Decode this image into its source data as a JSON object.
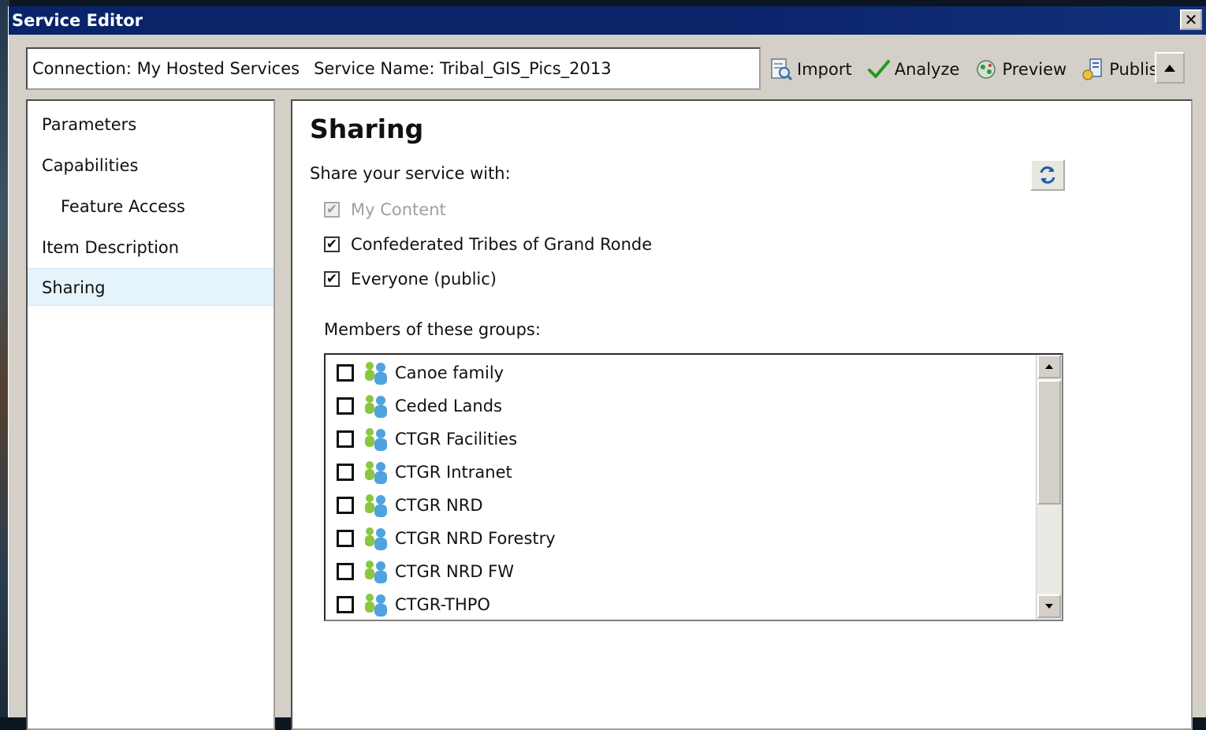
{
  "window": {
    "title": "Service Editor",
    "close_glyph": "✕"
  },
  "info": {
    "connection": "Connection: My Hosted Services",
    "service_name": "Service Name: Tribal_GIS_Pics_2013"
  },
  "toolbar": {
    "import_label": "Import",
    "analyze_label": "Analyze",
    "preview_label": "Preview",
    "publish_label": "Publish",
    "collapse_icon": "triangle-up-icon"
  },
  "nav": {
    "items": [
      {
        "label": "Parameters"
      },
      {
        "label": "Capabilities"
      },
      {
        "label": "Feature Access"
      },
      {
        "label": "Item Description"
      },
      {
        "label": "Sharing",
        "selected": true
      }
    ]
  },
  "sharing": {
    "title": "Sharing",
    "share_with_label": "Share your service with:",
    "options": [
      {
        "label": "My Content",
        "checked": true,
        "disabled": true
      },
      {
        "label": "Confederated Tribes of Grand Ronde",
        "checked": true,
        "disabled": false
      },
      {
        "label": "Everyone (public)",
        "checked": true,
        "disabled": false
      }
    ],
    "groups_label": "Members of these groups:",
    "groups": [
      {
        "name": "Canoe family",
        "checked": false
      },
      {
        "name": "Ceded Lands",
        "checked": false
      },
      {
        "name": "CTGR Facilities",
        "checked": false
      },
      {
        "name": "CTGR Intranet",
        "checked": false
      },
      {
        "name": "CTGR NRD",
        "checked": false
      },
      {
        "name": "CTGR NRD Forestry",
        "checked": false
      },
      {
        "name": "CTGR NRD FW",
        "checked": false
      },
      {
        "name": "CTGR-THPO",
        "checked": false
      }
    ],
    "check_glyph": "✔"
  },
  "colors": {
    "titlebar": "#0a246a",
    "window_bg": "#d4d0c8",
    "selected_nav": "#e5f3fb",
    "analyze_check": "#1f9a1f"
  }
}
